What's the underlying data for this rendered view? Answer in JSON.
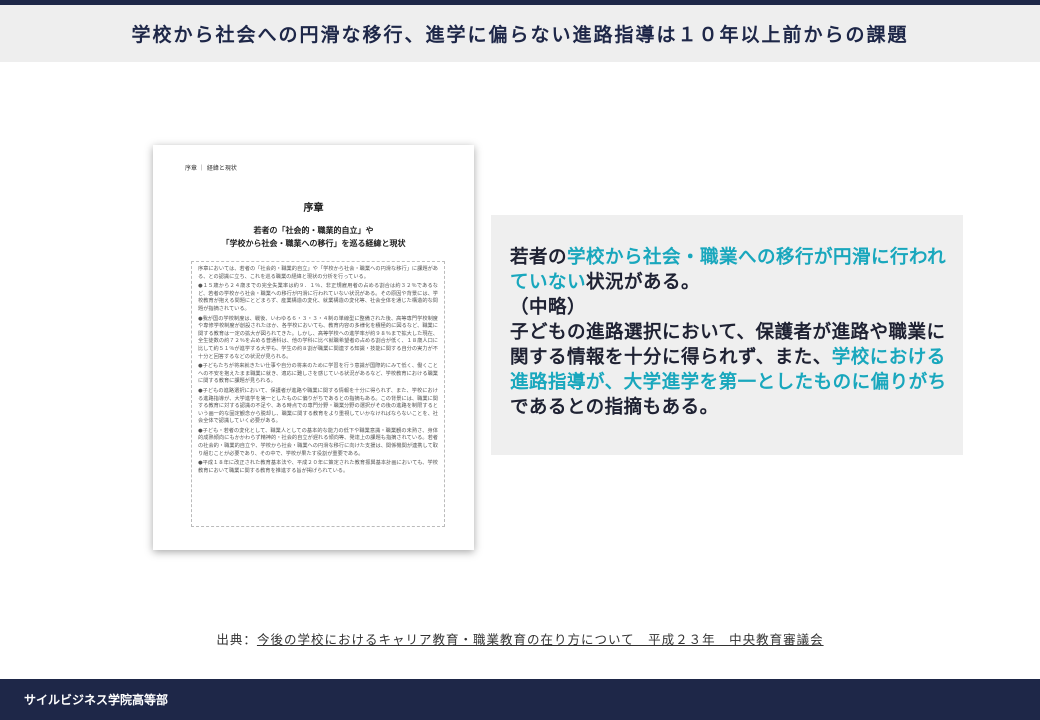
{
  "header": {
    "title": "学校から社会への円滑な移行、進学に偏らない進路指導は１０年以上前からの課題"
  },
  "document": {
    "header_label": "序章 ｜ 経緯と現状",
    "chapter": "序章",
    "subtitle_line1": "若者の「社会的・職業的自立」や",
    "subtitle_line2": "「学校から社会・職業への移行」を巡る経緯と現状",
    "paragraphs": [
      "序章においては、若者の「社会的・職業的自立」や「学校から社会・職業への円滑な移行」に課題がある、との認識に立ち、これを巡る職業の経緯と現状の分析を行っている。",
      "●１５歳から２４歳までの完全失業率は約９．１％、非正規雇用者の占める割合は約３２％であるなど、若者の学校から社会・職業への移行が円滑に行われていない状況がある。その原因や背景には、学校教育が抱える問題にとどまらず、産業構造の変化、就業構造の変化等、社会全体を通じた構造的な問題が指摘されている。",
      "●我が国の学校制度は、戦後、いわゆる６・３・３・４制の単線型に整備された後、高等専門学校制度や専修学校制度が創設されたほか、各学校においても、教育内容の多様化を積極的に図るなど、職業に関する教育は一定の拡大が図られてきた。しかし、高等学校への進学率が約９８％まで拡大した現在、全生徒数の約７２％を占める普通科は、他の学科に比べ就職希望者の占める割合が低く、１８歳人口に比して約５１％が進学する大学も、学生の約８割が職業に関連する知識・技能に関する自分の実力が不十分と回答するなどの状況が見られる。",
      "●子どもたちが将来就きたい仕事や自分の将来のために学習を行う意識が国際的にみて低く、働くことへの不安を抱えたまま職業に就き、適応に難しさを感じている状況があるなど、学校教育における職業に関する教育に課題が見られる。",
      "●子どもの進路選択において、保護者が進路や職業に関する情報を十分に得られず、また、学校における進路指導が、大学進学を第一としたものに偏りがちであるとの指摘もある。この背景には、職業に関する教育に対する認識の不足や、ある時点での専門分野・職業分野の選択がその後の進路を制限するという画一的な固定観念から脱却し、職業に関する教育をより重視していかなければならないことを、社会全体で認識していく必要がある。",
      "●子ども・若者の変化として、職業人としての基本的な能力の低下や職業意識・職業観の未熟さ、身体的成熟傾向にもかかわらず精神的・社会的自立が遅れる傾向等、発達上の課題も指摘されている。若者の社会的・職業的自立や、学校から社会・職業への円滑な移行に向けた支援は、関係機関が連携して取り組むことが必要であり、その中で、学校が果たす役割が重要である。",
      "●平成１８年に改正された教育基本法や、平成２０年に策定された教育振興基本計画においても、学校教育において職業に関する教育を推進する旨が掲げられている。"
    ]
  },
  "quote": {
    "p1_a": "若者の",
    "p1_hl": "学校から社会・職業への移行が円滑に行われていない",
    "p1_b": "状況がある。",
    "p2": "（中略）",
    "p3_a": "子どもの進路選択において、保護者が進路や職業に関する情報を十分に得られず、また、",
    "p3_hl": "学校における進路指導が、大学進学を第一としたものに偏りがち",
    "p3_b": "であるとの指摘もある。"
  },
  "source": {
    "prefix": "出典：",
    "link": "今後の学校におけるキャリア教育・職業教育の在り方について　平成２３年　中央教育審議会"
  },
  "footer": {
    "company": "サイルビジネス学院高等部"
  },
  "colors": {
    "navy": "#1e2748",
    "highlight": "#19a7bd",
    "panel": "#efefef"
  }
}
